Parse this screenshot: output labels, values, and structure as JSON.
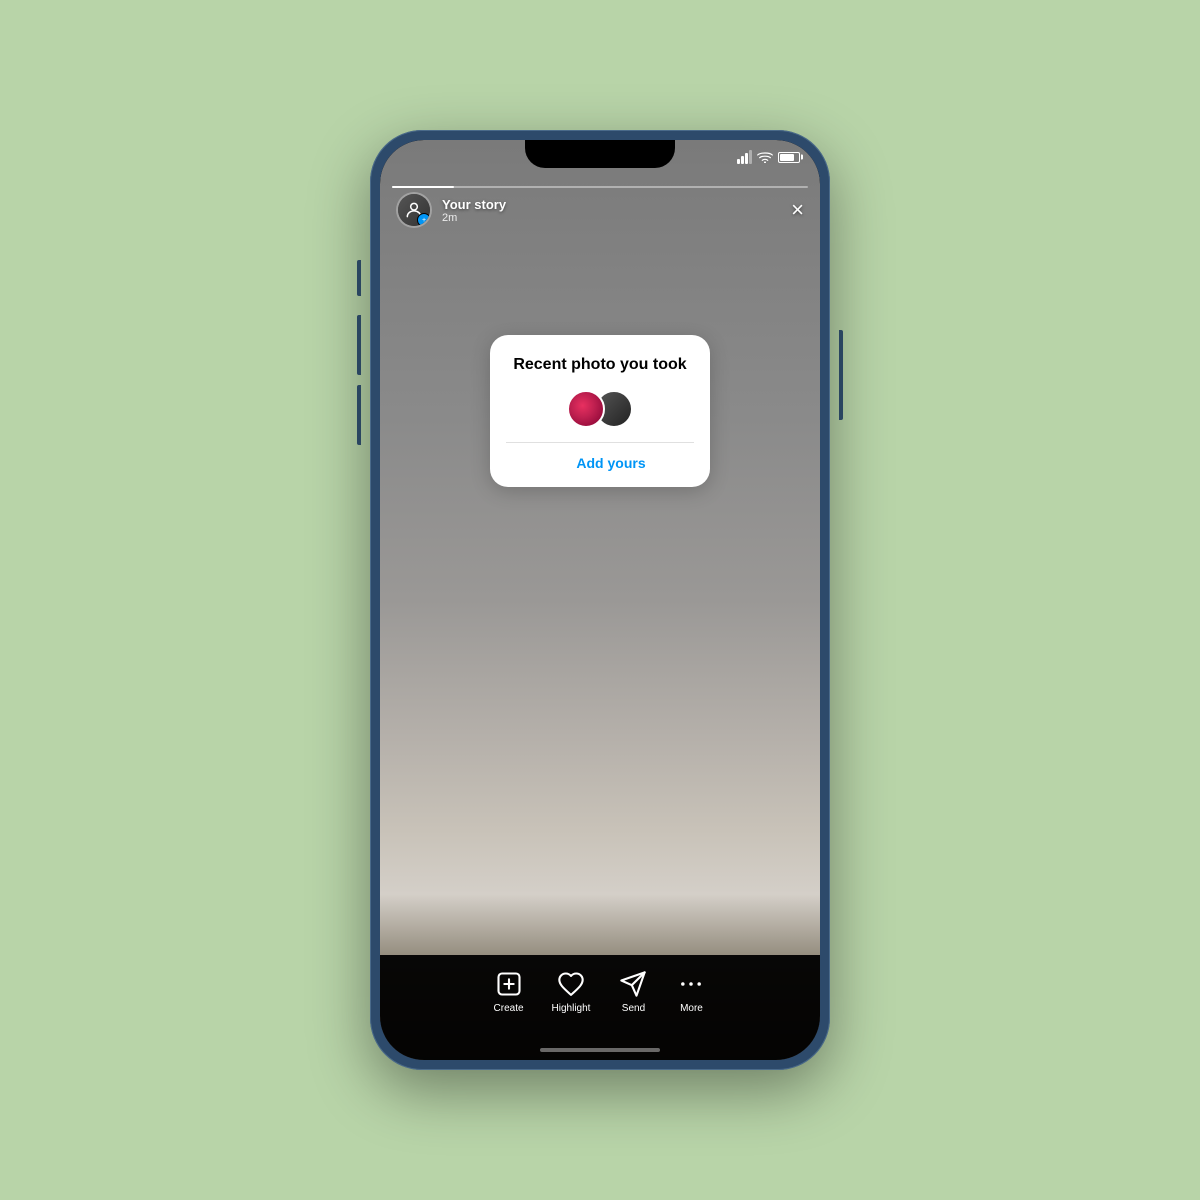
{
  "background": {
    "color": "#b8d4a8"
  },
  "statusBar": {
    "signalLabel": "signal",
    "wifiLabel": "wifi",
    "batteryLabel": "battery"
  },
  "storyHeader": {
    "username": "Your story",
    "time": "2m",
    "closeLabel": "×"
  },
  "popupCard": {
    "title": "Recent photo you took",
    "addYoursLabel": "Add yours"
  },
  "bottomBar": {
    "actions": [
      {
        "id": "create",
        "label": "Create"
      },
      {
        "id": "highlight",
        "label": "Highlight"
      },
      {
        "id": "send",
        "label": "Send"
      },
      {
        "id": "more",
        "label": "More"
      }
    ]
  },
  "homeIndicator": {}
}
